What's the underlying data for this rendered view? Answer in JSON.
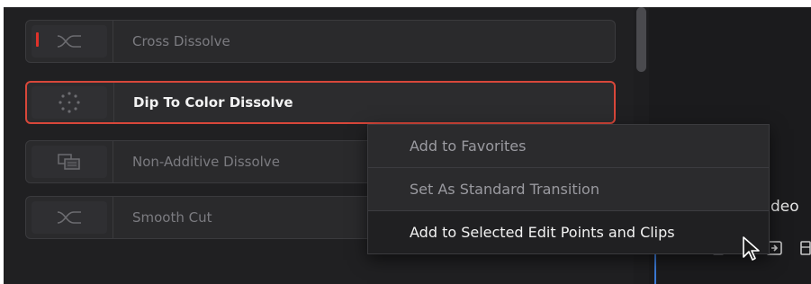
{
  "transitions": [
    {
      "label": "Cross Dissolve",
      "icon": "cross-dissolve-icon",
      "selected": false,
      "favorite": true
    },
    {
      "label": "Dip To Color Dissolve",
      "icon": "dip-to-color-icon",
      "selected": true,
      "favorite": false
    },
    {
      "label": "Non-Additive Dissolve",
      "icon": "non-additive-dissolve-icon",
      "selected": false,
      "favorite": false
    },
    {
      "label": "Smooth Cut",
      "icon": "smooth-cut-icon",
      "selected": false,
      "favorite": false
    }
  ],
  "context_menu": {
    "items": [
      {
        "label": "Add to Favorites"
      },
      {
        "label": "Set As Standard Transition"
      },
      {
        "label": "Add to Selected Edit Points and Clips"
      }
    ],
    "hovered_index": 2
  },
  "right_panel": {
    "video_label": "Video"
  },
  "colors": {
    "selection_border": "#d8473a",
    "favorite_marker": "#e0322a",
    "playhead_line": "#3b7ad6"
  }
}
